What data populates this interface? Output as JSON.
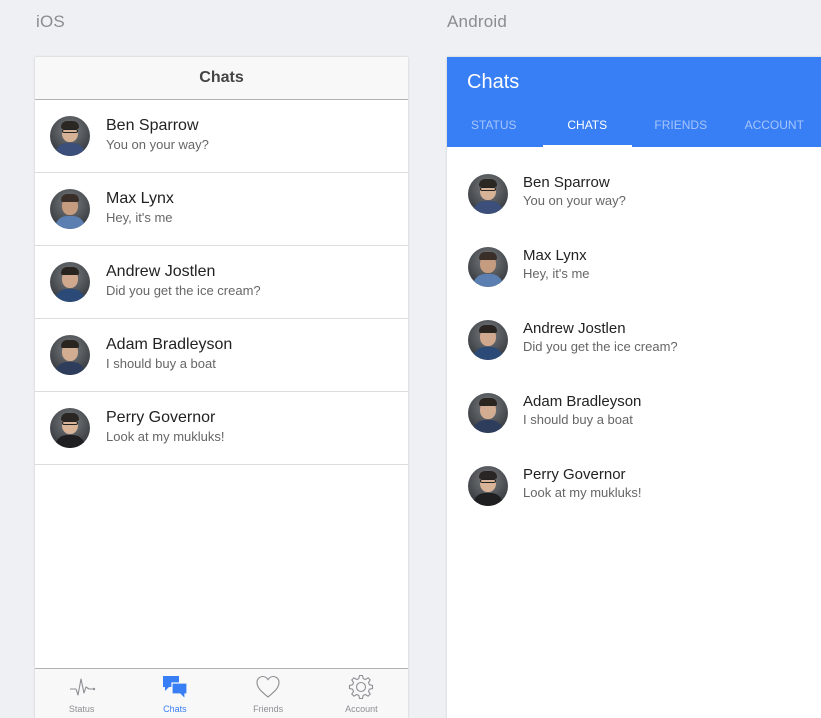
{
  "labels": {
    "ios": "iOS",
    "android": "Android"
  },
  "ios": {
    "title": "Chats",
    "tabs": [
      {
        "label": "Status",
        "icon": "pulse-icon"
      },
      {
        "label": "Chats",
        "icon": "chat-bubbles-icon"
      },
      {
        "label": "Friends",
        "icon": "heart-icon"
      },
      {
        "label": "Account",
        "icon": "gear-icon"
      }
    ],
    "active_tab": "Chats"
  },
  "android": {
    "title": "Chats",
    "tabs": [
      "STATUS",
      "CHATS",
      "FRIENDS",
      "ACCOUNT"
    ],
    "active_tab": "CHATS"
  },
  "chats": [
    {
      "name": "Ben Sparrow",
      "message": "You on your way?"
    },
    {
      "name": "Max Lynx",
      "message": "Hey, it's me"
    },
    {
      "name": "Andrew Jostlen",
      "message": "Did you get the ice cream?"
    },
    {
      "name": "Adam Bradleyson",
      "message": "I should buy a boat"
    },
    {
      "name": "Perry Governor",
      "message": "Look at my mukluks!"
    }
  ],
  "colors": {
    "accent": "#387ef5",
    "background": "#eff0f4",
    "inactive_tab": "#8e8e93"
  }
}
